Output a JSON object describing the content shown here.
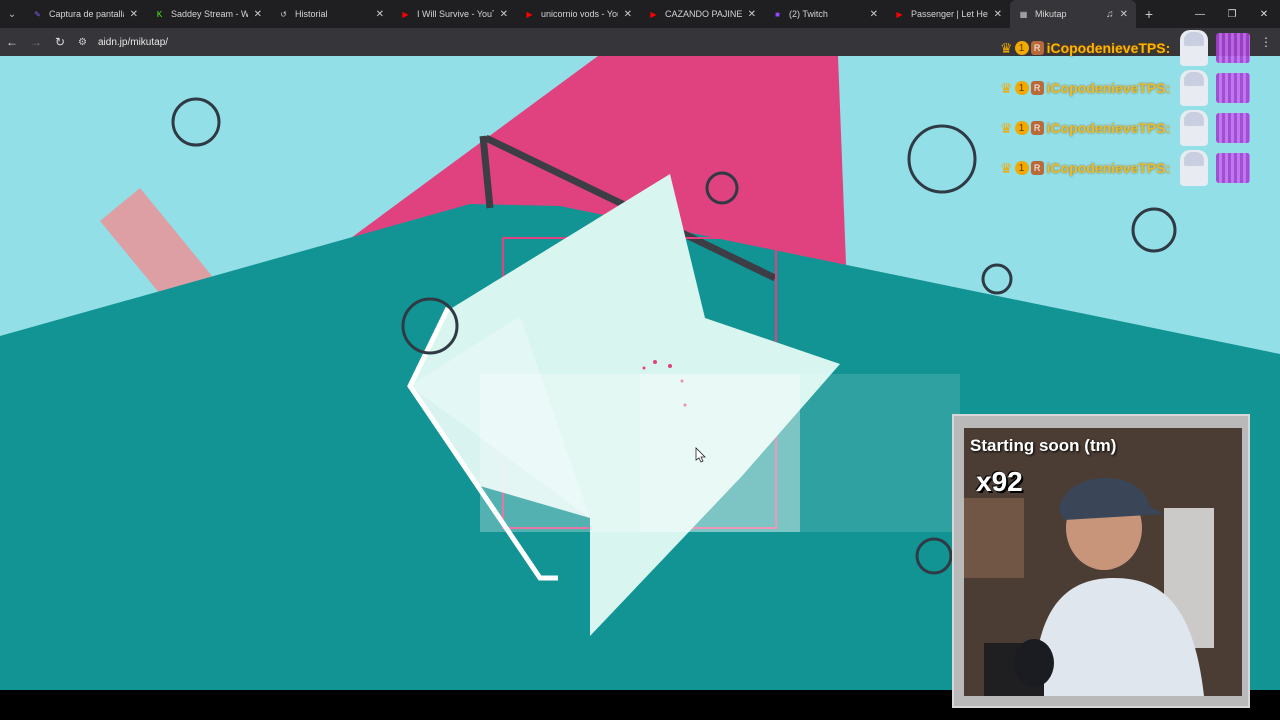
{
  "browser": {
    "tabs": [
      {
        "title": "Captura de pantalla p",
        "icon": "pen-icon",
        "color": "#8b5cf6"
      },
      {
        "title": "Saddey Stream - Wat",
        "icon": "kick-icon",
        "color": "#53fc18"
      },
      {
        "title": "Historial",
        "icon": "history-icon",
        "color": "#cccccc"
      },
      {
        "title": "I Will Survive - YouTu",
        "icon": "youtube-icon",
        "color": "#ff0000"
      },
      {
        "title": "unicornio vods - You",
        "icon": "youtube-icon",
        "color": "#ff0000"
      },
      {
        "title": "CAZANDO PAJINES #",
        "icon": "youtube-icon",
        "color": "#ff0000"
      },
      {
        "title": "(2) Twitch",
        "icon": "twitch-icon",
        "color": "#9146ff"
      },
      {
        "title": "Passenger | Let Her G",
        "icon": "youtube-icon",
        "color": "#ff0000"
      },
      {
        "title": "Mikutap",
        "icon": "grid-icon",
        "color": "#cccccc"
      }
    ],
    "url": "aidn.jp/mikutap/"
  },
  "overlay": {
    "sub_alerts": [
      {
        "name": "iCopodenieveTPS:"
      },
      {
        "name": "iCopodenieveTPS:"
      },
      {
        "name": "iCopodenieveTPS:"
      },
      {
        "name": "iCopodenieveTPS:"
      }
    ],
    "badge_count": "1",
    "badge_letter": "R",
    "webcam_title": "Starting soon (tm)",
    "combo": "x92"
  },
  "colors": {
    "sky": "#92dfe8",
    "teal": "#139494",
    "pink": "#e0427f",
    "mint": "#d8f5ef",
    "salmon": "#e6989b"
  }
}
